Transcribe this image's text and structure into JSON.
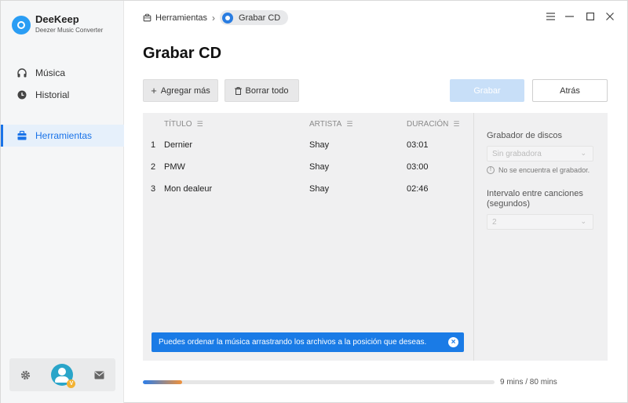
{
  "app": {
    "name": "DeeKeep",
    "subtitle": "Deezer Music Converter"
  },
  "sidebar": {
    "items": [
      {
        "label": "Música",
        "icon": "headphones-icon"
      },
      {
        "label": "Historial",
        "icon": "clock-icon"
      },
      {
        "label": "Herramientas",
        "icon": "toolbox-icon",
        "active": true
      }
    ],
    "bottom": {
      "settings_icon": "gear-icon",
      "avatar_badge": "V",
      "mail_icon": "mail-icon"
    }
  },
  "breadcrumb": {
    "parent": "Herramientas",
    "separator": "›",
    "current": "Grabar CD"
  },
  "window_controls": [
    "menu-icon",
    "minimize-icon",
    "maximize-icon",
    "close-icon"
  ],
  "page": {
    "title": "Grabar CD"
  },
  "toolbar": {
    "add_label": "Agregar más",
    "clear_label": "Borrar todo",
    "burn_label": "Grabar",
    "back_label": "Atrás"
  },
  "table": {
    "columns": [
      "TÍTULO",
      "ARTISTA",
      "DURACIÓN"
    ],
    "rows": [
      {
        "num": "1",
        "title": "Dernier",
        "artist": "Shay",
        "duration": "03:01"
      },
      {
        "num": "2",
        "title": "PMW",
        "artist": "Shay",
        "duration": "03:00"
      },
      {
        "num": "3",
        "title": "Mon dealeur",
        "artist": "Shay",
        "duration": "02:46"
      }
    ]
  },
  "settings": {
    "burner_label": "Grabador de discos",
    "burner_value": "Sin grabadora",
    "burner_warning": "No se encuentra el grabador.",
    "interval_label_1": "Intervalo entre canciones",
    "interval_label_2": "(segundos)",
    "interval_value": "2"
  },
  "tip": {
    "text": "Puedes ordenar la música arrastrando los archivos a la posición que deseas."
  },
  "capacity": {
    "text": "9 mins / 80 mins",
    "used_fraction": 0.1125
  },
  "colors": {
    "accent": "#1a73e8",
    "burn_button_disabled": "#c8dff8",
    "tip_background": "#1a7be6"
  }
}
